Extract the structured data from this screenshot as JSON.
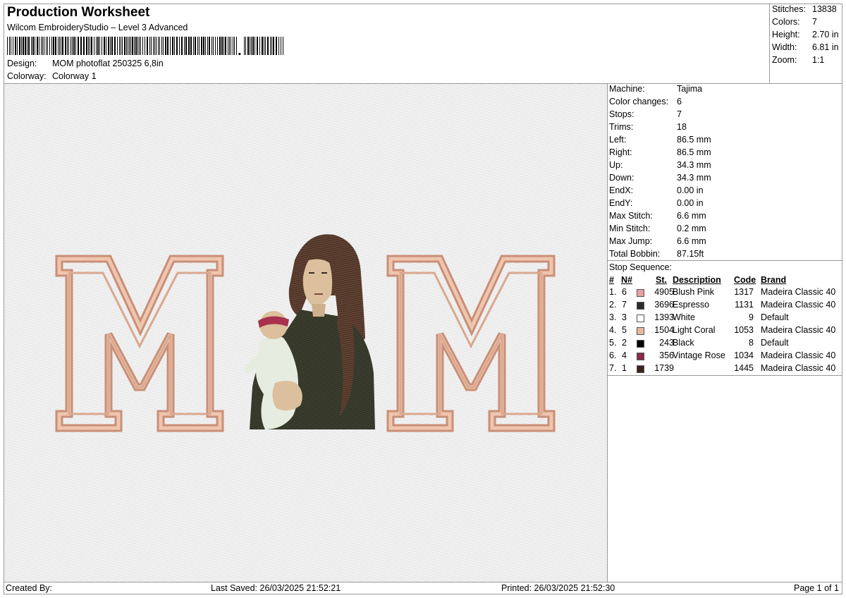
{
  "header": {
    "title": "Production Worksheet",
    "software": "Wilcom EmbroideryStudio – Level 3 Advanced",
    "design_label": "Design:",
    "design_value": "MOM photoflat 250325 6,8in",
    "colorway_label": "Colorway:",
    "colorway_value": "Colorway 1"
  },
  "summary": {
    "stitches_label": "Stitches:",
    "stitches": "13838",
    "colors_label": "Colors:",
    "colors": "7",
    "height_label": "Height:",
    "height": "2.70 in",
    "width_label": "Width:",
    "width": "6.81 in",
    "zoom_label": "Zoom:",
    "zoom": "1:1"
  },
  "machine_info": [
    {
      "label": "Machine:",
      "value": "Tajima"
    },
    {
      "label": "Color changes:",
      "value": "6"
    },
    {
      "label": "Stops:",
      "value": "7"
    },
    {
      "label": "Trims:",
      "value": "18"
    },
    {
      "label": "Left:",
      "value": "86.5 mm"
    },
    {
      "label": "Right:",
      "value": "86.5 mm"
    },
    {
      "label": "Up:",
      "value": "34.3 mm"
    },
    {
      "label": "Down:",
      "value": "34.3 mm"
    },
    {
      "label": "EndX:",
      "value": "0.00 in"
    },
    {
      "label": "EndY:",
      "value": "0.00 in"
    },
    {
      "label": "Max Stitch:",
      "value": "6.6 mm"
    },
    {
      "label": "Min Stitch:",
      "value": "0.2 mm"
    },
    {
      "label": "Max Jump:",
      "value": "6.6 mm"
    },
    {
      "label": "Total Bobbin:",
      "value": "87.15ft"
    }
  ],
  "stop_sequence": {
    "title": "Stop Sequence:",
    "headers": {
      "num": "#",
      "n": "N#",
      "st": "St.",
      "description": "Description",
      "code": "Code",
      "brand": "Brand"
    },
    "rows": [
      {
        "num": "1.",
        "n": "6",
        "color": "#e8a0a0",
        "st": "4905",
        "description": "Blush Pink",
        "code": "1317",
        "brand": "Madeira Classic 40"
      },
      {
        "num": "2.",
        "n": "7",
        "color": "#2a2a2a",
        "st": "3696",
        "description": "Espresso",
        "code": "1131",
        "brand": "Madeira Classic 40"
      },
      {
        "num": "3.",
        "n": "3",
        "color": "#ffffff",
        "st": "1393",
        "description": "White",
        "code": "9",
        "brand": "Default"
      },
      {
        "num": "4.",
        "n": "5",
        "color": "#e8b8a0",
        "st": "1504",
        "description": "Light Coral",
        "code": "1053",
        "brand": "Madeira Classic 40"
      },
      {
        "num": "5.",
        "n": "2",
        "color": "#000000",
        "st": "243",
        "description": "Black",
        "code": "8",
        "brand": "Default"
      },
      {
        "num": "6.",
        "n": "4",
        "color": "#8a2a4a",
        "st": "356",
        "description": "Vintage Rose",
        "code": "1034",
        "brand": "Madeira Classic 40"
      },
      {
        "num": "7.",
        "n": "1",
        "color": "#3a2420",
        "st": "1739",
        "description": "",
        "code": "1445",
        "brand": "Madeira Classic 40"
      }
    ]
  },
  "footer": {
    "created_by": "Created By:",
    "last_saved": "Last Saved: 26/03/2025 21:52:21",
    "printed": "Printed: 26/03/2025 21:52:30",
    "page": "Page 1 of 1"
  },
  "design_preview": {
    "icon": "embroidery-preview-image",
    "colors": {
      "letter_fill": "#e3b49c",
      "letter_edge": "#c98f78",
      "hair": "#4e3528",
      "skin": "#dcc09e",
      "coat": "#3d3f30",
      "baby_suit": "#e6ece0",
      "headband": "#a8324e"
    }
  }
}
